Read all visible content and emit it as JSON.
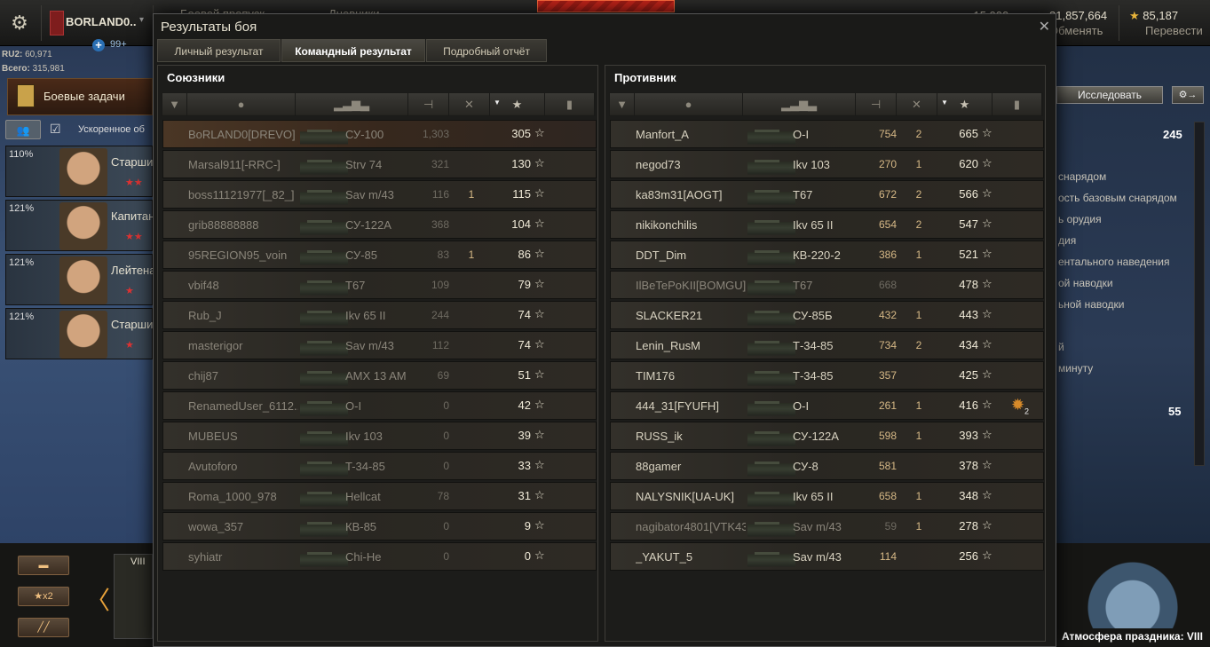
{
  "topbar": {
    "player_name": "BORLAND0..",
    "plus_count": "99+",
    "stat_ru2_label": "RU2:",
    "stat_ru2_value": "60,971",
    "stat_total_label": "Всего:",
    "stat_total_value": "315,981",
    "section_a": "Боевой пропуск",
    "section_b": "Дневники",
    "credits_value": "15,000",
    "gold_value": "81,857,664",
    "gold_sub": "Обменять",
    "freexp_value": "85,187",
    "freexp_sub": "Перевести"
  },
  "left": {
    "missions_label": "Боевые задачи",
    "accel_label": "Ускоренное об",
    "crew": [
      {
        "pct": "110%",
        "rank": "Старший"
      },
      {
        "pct": "121%",
        "rank": "Капитан"
      },
      {
        "pct": "121%",
        "rank": "Лейтенант"
      },
      {
        "pct": "121%",
        "rank": "Старший"
      }
    ],
    "carousel_x2": "x2",
    "tier_card": "VIII"
  },
  "right": {
    "research_label": "Исследовать",
    "value_top": "245",
    "value_bottom": "55",
    "lines": [
      "снарядом",
      "ость базовым снарядом",
      "ь орудия",
      "дия",
      "ентального наведения",
      "ой наводки",
      "ьной наводки",
      "й",
      "минуту"
    ],
    "holiday_label": "Атмосфера праздника: VIII"
  },
  "modal": {
    "title": "Результаты боя",
    "tabs": [
      "Личный результат",
      "Командный результат",
      "Подробный отчёт"
    ],
    "active_tab": "Командный результат"
  },
  "allies": {
    "title": "Союзники",
    "rows": [
      {
        "name": "BoRLAND0[DREVO]",
        "tank": "СУ-100",
        "dmg": "1,303",
        "kills": "",
        "xp": "305",
        "player": true,
        "alive": false
      },
      {
        "name": "Marsal911[-RRC-]",
        "tank": "Strv 74",
        "dmg": "321",
        "kills": "",
        "xp": "130",
        "alive": false
      },
      {
        "name": "boss11121977[_82_]",
        "tank": "Sav m/43",
        "dmg": "116",
        "kills": "1",
        "xp": "115",
        "alive": false
      },
      {
        "name": "grib88888888",
        "tank": "СУ-122А",
        "dmg": "368",
        "kills": "",
        "xp": "104",
        "alive": false
      },
      {
        "name": "95REGION95_voin",
        "tank": "СУ-85",
        "dmg": "83",
        "kills": "1",
        "xp": "86",
        "alive": false
      },
      {
        "name": "vbif48",
        "tank": "T67",
        "dmg": "109",
        "kills": "",
        "xp": "79",
        "alive": false
      },
      {
        "name": "Rub_J",
        "tank": "Ikv 65 II",
        "dmg": "244",
        "kills": "",
        "xp": "74",
        "alive": false
      },
      {
        "name": "masterigor",
        "tank": "Sav m/43",
        "dmg": "112",
        "kills": "",
        "xp": "74",
        "alive": false
      },
      {
        "name": "chij87",
        "tank": "AMX 13 AM",
        "dmg": "69",
        "kills": "",
        "xp": "51",
        "alive": false
      },
      {
        "name": "RenamedUser_6112..",
        "tank": "O-I",
        "dmg": "0",
        "kills": "",
        "xp": "42",
        "alive": false
      },
      {
        "name": "MUBEUS",
        "tank": "Ikv 103",
        "dmg": "0",
        "kills": "",
        "xp": "39",
        "alive": false
      },
      {
        "name": "Avutoforo",
        "tank": "T-34-85",
        "dmg": "0",
        "kills": "",
        "xp": "33",
        "alive": false
      },
      {
        "name": "Roma_1000_978",
        "tank": "Hellcat",
        "dmg": "78",
        "kills": "",
        "xp": "31",
        "alive": false
      },
      {
        "name": "wowa_357",
        "tank": "КВ-85",
        "dmg": "0",
        "kills": "",
        "xp": "9",
        "alive": false
      },
      {
        "name": "syhiatr",
        "tank": "Chi-He",
        "dmg": "0",
        "kills": "",
        "xp": "0",
        "alive": false
      }
    ]
  },
  "enemies": {
    "title": "Противник",
    "rows": [
      {
        "name": "Manfort_A",
        "tank": "O-I",
        "dmg": "754",
        "kills": "2",
        "xp": "665",
        "alive": true
      },
      {
        "name": "negod73",
        "tank": "Ikv 103",
        "dmg": "270",
        "kills": "1",
        "xp": "620",
        "alive": true
      },
      {
        "name": "ka83m31[AOGT]",
        "tank": "T67",
        "dmg": "672",
        "kills": "2",
        "xp": "566",
        "alive": true
      },
      {
        "name": "nikikonchilis",
        "tank": "Ikv 65 II",
        "dmg": "654",
        "kills": "2",
        "xp": "547",
        "alive": true
      },
      {
        "name": "DDT_Dim",
        "tank": "КВ-220-2",
        "dmg": "386",
        "kills": "1",
        "xp": "521",
        "alive": true
      },
      {
        "name": "IlBeTePoKII[BOMGU]",
        "tank": "T67",
        "dmg": "668",
        "kills": "",
        "xp": "478",
        "alive": false
      },
      {
        "name": "SLACKER21",
        "tank": "СУ-85Б",
        "dmg": "432",
        "kills": "1",
        "xp": "443",
        "alive": true
      },
      {
        "name": "Lenin_RusM",
        "tank": "Т-34-85",
        "dmg": "734",
        "kills": "2",
        "xp": "434",
        "alive": true
      },
      {
        "name": "TIM176",
        "tank": "Т-34-85",
        "dmg": "357",
        "kills": "",
        "xp": "425",
        "alive": true
      },
      {
        "name": "444_31[FYUFH]",
        "tank": "O-I",
        "dmg": "261",
        "kills": "1",
        "xp": "416",
        "alive": true,
        "medal": "2"
      },
      {
        "name": "RUSS_ik",
        "tank": "СУ-122А",
        "dmg": "598",
        "kills": "1",
        "xp": "393",
        "alive": true
      },
      {
        "name": "88gamer",
        "tank": "СУ-8",
        "dmg": "581",
        "kills": "",
        "xp": "378",
        "alive": true
      },
      {
        "name": "NALYSNIK[UA-UK]",
        "tank": "Ikv 65 II",
        "dmg": "658",
        "kills": "1",
        "xp": "348",
        "alive": true
      },
      {
        "name": "nagibator4801[VTK43]",
        "tank": "Sav m/43",
        "dmg": "59",
        "kills": "1",
        "xp": "278",
        "alive": false
      },
      {
        "name": "_YAKUT_5",
        "tank": "Sav m/43",
        "dmg": "114",
        "kills": "",
        "xp": "256",
        "alive": true
      }
    ]
  },
  "icons": {
    "settings": "gear-icon",
    "star": "star-icon",
    "close": "close-icon",
    "col_badge": "badge-icon",
    "col_player": "person-icon",
    "col_tank": "tank-icon",
    "col_damage": "damage-icon",
    "col_kills": "kills-icon",
    "col_xp": "xp-star-icon",
    "col_medal": "medal-icon"
  }
}
